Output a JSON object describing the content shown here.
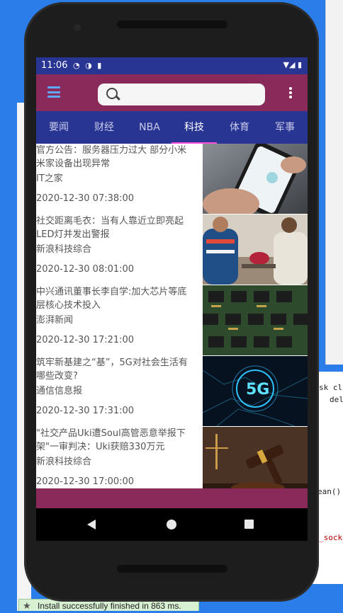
{
  "status_bar": {
    "time": "11:06"
  },
  "toolbar": {
    "search_placeholder": ""
  },
  "tabs": [
    {
      "label": "要闻"
    },
    {
      "label": "财经"
    },
    {
      "label": "NBA"
    },
    {
      "label": "科技",
      "active": true
    },
    {
      "label": "体育"
    },
    {
      "label": "军事"
    }
  ],
  "news": [
    {
      "title": "官方公告：服务器压力过大 部分小米米家设备出现异常",
      "source": "IT之家",
      "date": "2020-12-30 07:38:00"
    },
    {
      "title": "社交距离毛衣：当有人靠近立即亮起LED灯并发出警报",
      "source": "新浪科技综合",
      "date": "2020-12-30 08:01:00"
    },
    {
      "title": "中兴通讯董事长李自学:加大芯片等底层核心技术投入",
      "source": "澎湃新闻",
      "date": "2020-12-30 17:21:00"
    },
    {
      "title": "筑牢新基建之“基”，5G对社会生活有哪些改变?",
      "source": "通信信息报",
      "date": "2020-12-30 17:31:00"
    },
    {
      "title": "\"社交产品Uki遭Soul高管恶意举报下架\"一审判决：Uki获赔330万元",
      "source": "新浪科技综合",
      "date": "2020-12-30 17:00:00"
    }
  ],
  "ide": {
    "code_line_1": "sk cl",
    "code_line_2": "del",
    "code_line_3": "ean()",
    "code_line_4": "_socke",
    "toast": "Install successfully finished in 863 ms."
  },
  "colors": {
    "status_bar": "#283593",
    "toolbar": "#8a2a5a",
    "tab_indicator": "#ff4fd8"
  }
}
